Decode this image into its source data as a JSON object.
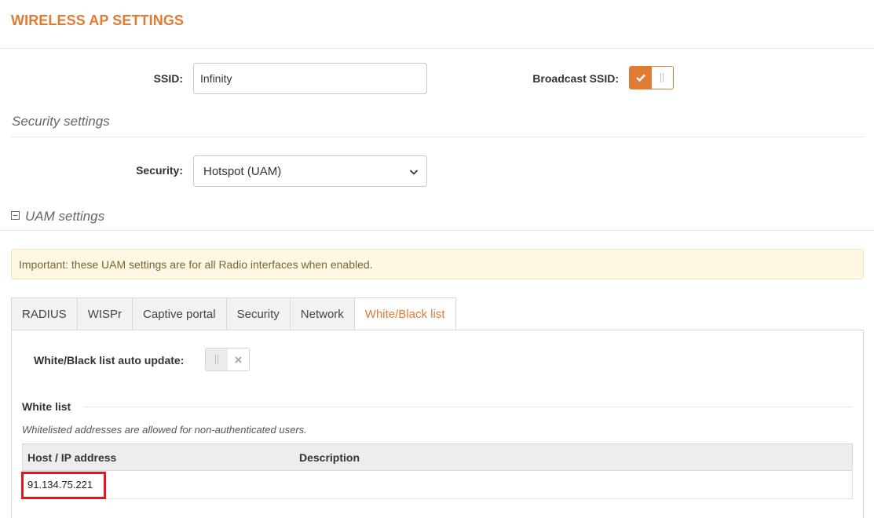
{
  "page": {
    "title": "WIRELESS AP SETTINGS"
  },
  "ssid": {
    "label": "SSID:",
    "value": "Infinity"
  },
  "broadcast": {
    "label": "Broadcast SSID:",
    "enabled": true
  },
  "security_section": {
    "heading": "Security settings"
  },
  "security": {
    "label": "Security:",
    "selected": "Hotspot (UAM)"
  },
  "uam": {
    "heading": "UAM settings",
    "alert": "Important: these UAM settings are for all Radio interfaces when enabled."
  },
  "tabs": [
    {
      "label": "RADIUS"
    },
    {
      "label": "WISPr"
    },
    {
      "label": "Captive portal"
    },
    {
      "label": "Security"
    },
    {
      "label": "Network"
    },
    {
      "label": "White/Black list",
      "active": true
    }
  ],
  "auto_update": {
    "label": "White/Black list auto update:",
    "enabled": false
  },
  "whitelist": {
    "legend": "White list",
    "note": "Whitelisted addresses are allowed for non-authenticated users.",
    "columns": [
      "Host / IP address",
      "Description"
    ],
    "rows": [
      {
        "host": "91.134.75.221",
        "description": ""
      }
    ]
  },
  "colors": {
    "accent": "#e07b33",
    "highlight": "#e3161b",
    "alert_bg": "#fdf7e3"
  },
  "icons": {
    "check": "check-icon",
    "cross": "close-icon",
    "bars": "toggle-handle-icon",
    "collapse": "minus-square-icon",
    "chevron": "chevron-down-icon"
  }
}
